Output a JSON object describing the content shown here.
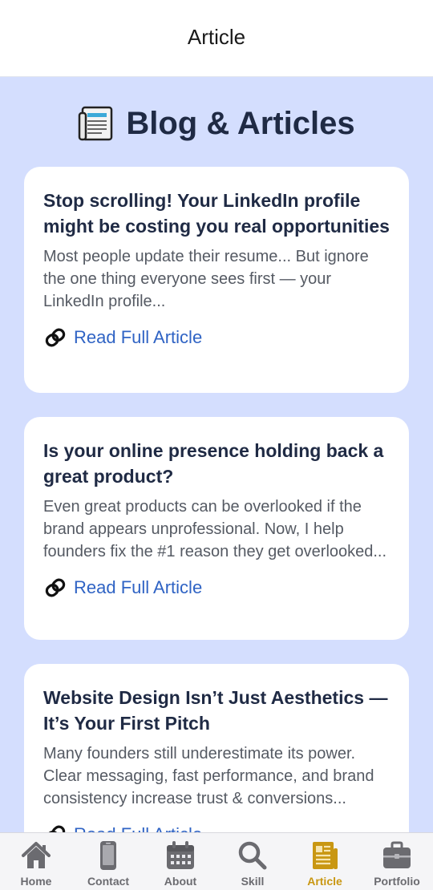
{
  "header": {
    "title": "Article"
  },
  "page": {
    "heading": "Blog & Articles"
  },
  "articles": [
    {
      "title": "Stop scrolling! Your LinkedIn profile might be costing you real opportunities",
      "excerpt": "Most people update their resume... But ignore the one thing everyone sees first — your LinkedIn profile...",
      "link_label": "Read Full Article"
    },
    {
      "title": "Is your online presence holding back a great product?",
      "excerpt": "Even great products can be overlooked if the brand appears unprofessional. Now, I help founders fix the #1 reason they get overlooked...",
      "link_label": "Read Full Article"
    },
    {
      "title": "Website Design Isn’t Just Aesthetics — It’s Your First Pitch",
      "excerpt": "Many founders still underestimate its power. Clear messaging, fast performance, and brand consistency increase trust & conversions...",
      "link_label": "Read Full Article"
    }
  ],
  "nav": {
    "active": "Article",
    "items": [
      {
        "label": "Home",
        "icon": "home-icon"
      },
      {
        "label": "Contact",
        "icon": "phone-icon"
      },
      {
        "label": "About",
        "icon": "calendar-icon"
      },
      {
        "label": "Skill",
        "icon": "search-icon"
      },
      {
        "label": "Article",
        "icon": "document-icon"
      },
      {
        "label": "Portfolio",
        "icon": "briefcase-icon"
      }
    ]
  },
  "colors": {
    "background": "#d4defe",
    "heading": "#1f2a44",
    "link": "#2f63c4",
    "nav_active": "#c99712",
    "nav_inactive": "#6b6b70"
  }
}
